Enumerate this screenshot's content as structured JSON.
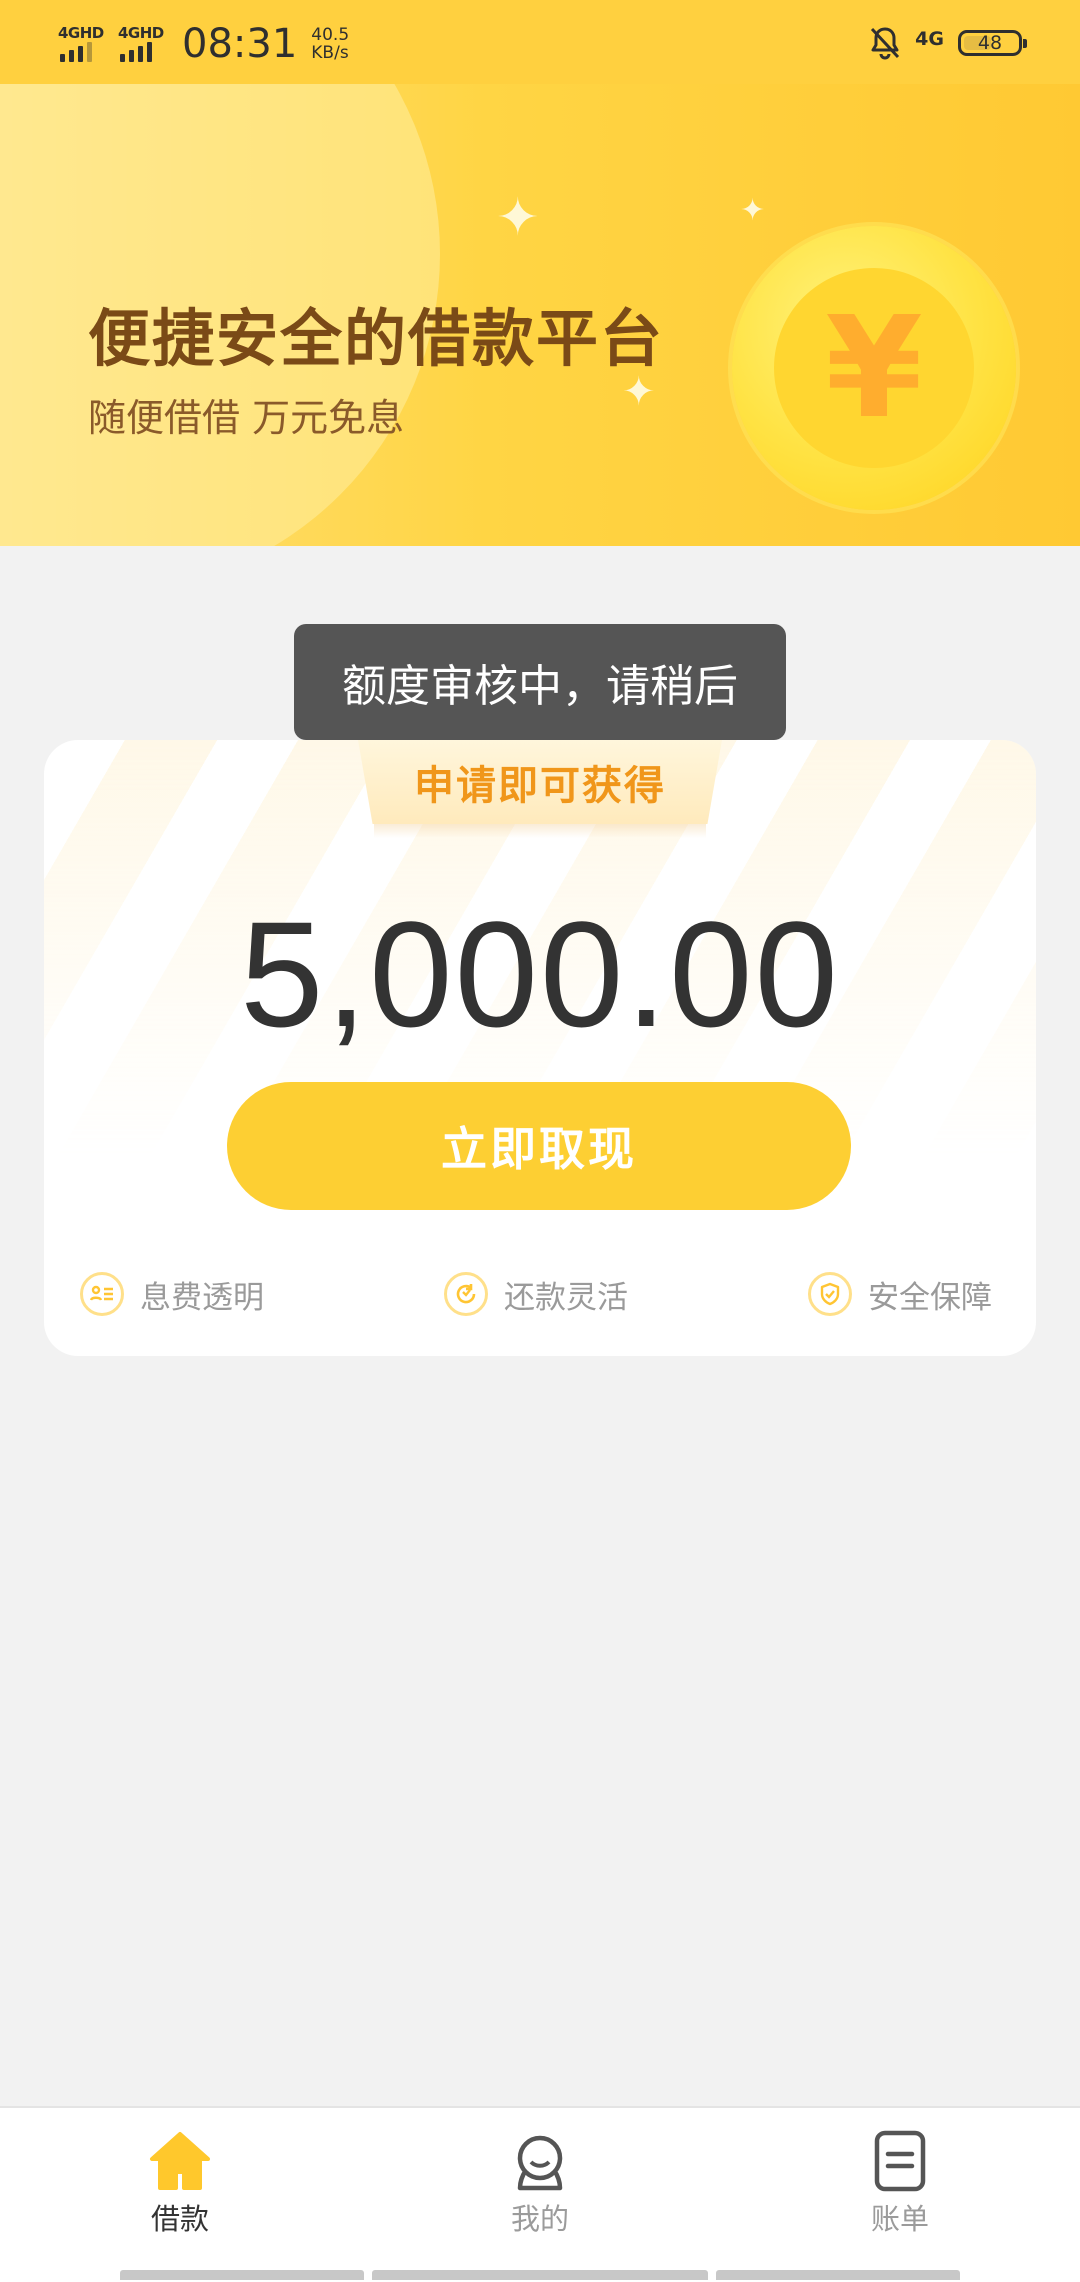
{
  "status_bar": {
    "network_1": "4GHD",
    "network_2": "4GHD",
    "time": "08:31",
    "speed_value": "40.5",
    "speed_unit": "KB/s",
    "mobile_data": "4G",
    "battery": "48"
  },
  "hero": {
    "title": "便捷安全的借款平台",
    "subtitle": "随便借借 万元免息",
    "coin_symbol": "¥"
  },
  "toast": {
    "message": "额度审核中，请稍后"
  },
  "card": {
    "ribbon_label": "申请即可获得",
    "amount": "5,000.00",
    "withdraw_label": "立即取现",
    "features": [
      {
        "label": "息费透明",
        "icon": "fee-list-icon"
      },
      {
        "label": "还款灵活",
        "icon": "flexible-repay-icon"
      },
      {
        "label": "安全保障",
        "icon": "shield-check-icon"
      }
    ]
  },
  "bottom_nav": {
    "items": [
      {
        "label": "借款",
        "icon": "home-icon",
        "active": true
      },
      {
        "label": "我的",
        "icon": "user-icon",
        "active": false
      },
      {
        "label": "账单",
        "icon": "bill-icon",
        "active": false
      }
    ]
  },
  "colors": {
    "brand_yellow": "#fdcf33",
    "hero_title": "#7a4a17",
    "ribbon_text": "#f0961a",
    "amount_text": "#333333",
    "toast_bg": "#505050"
  }
}
